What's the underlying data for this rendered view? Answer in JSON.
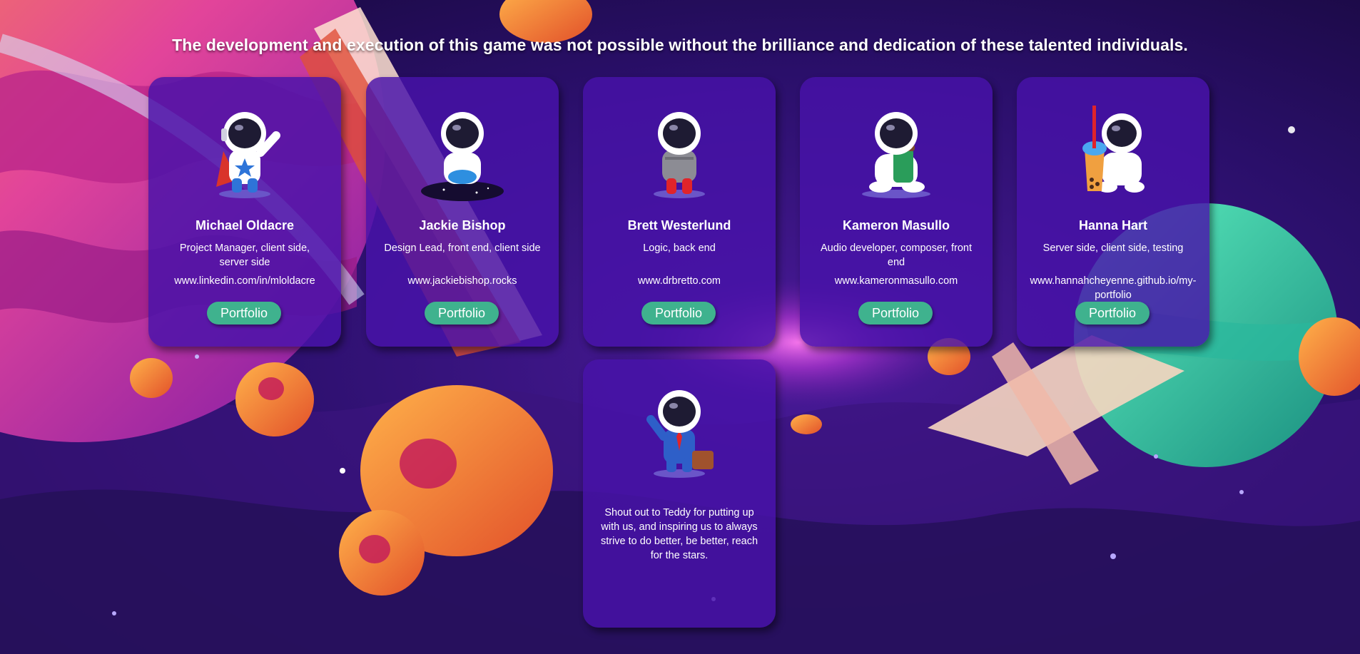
{
  "page": {
    "headline": "The development and execution of this game was not possible without the brilliance and dedication of these talented individuals."
  },
  "team": [
    {
      "name": "Michael Oldacre",
      "role": "Project Manager, client side, server side",
      "link": "www.linkedin.com/in/mloldacre",
      "button": "Portfolio",
      "avatar": "astronaut-superhero-icon"
    },
    {
      "name": "Jackie Bishop",
      "role": "Design Lead, front end, client side",
      "link": "www.jackiebishop.rocks",
      "button": "Portfolio",
      "avatar": "astronaut-dj-icon"
    },
    {
      "name": "Brett Westerlund",
      "role": "Logic, back end",
      "link": "www.drbretto.com",
      "button": "Portfolio",
      "avatar": "astronaut-hoodie-icon"
    },
    {
      "name": "Kameron Masullo",
      "role": "Audio developer, composer, front end",
      "link": "www.kameronmasullo.com",
      "button": "Portfolio",
      "avatar": "astronaut-coffee-icon"
    },
    {
      "name": "Hanna Hart",
      "role": "Server side, client side, testing",
      "link": "www.hannahcheyenne.github.io/my-portfolio",
      "button": "Portfolio",
      "avatar": "astronaut-boba-icon"
    }
  ],
  "tribute": {
    "text": "Shout out to Teddy for putting up with us, and inspiring us to always strive to do better, be better, reach for the stars.",
    "avatar": "astronaut-businessman-icon"
  },
  "colors": {
    "card_bg": "#4812aa",
    "button_bg": "#3fb28e",
    "space_bg": "#1a0b45"
  }
}
